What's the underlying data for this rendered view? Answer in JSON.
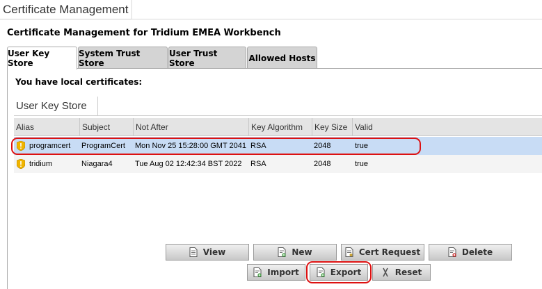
{
  "window": {
    "title": "Certificate Management"
  },
  "heading": "Certificate Management for Tridium EMEA Workbench",
  "tabs": [
    {
      "label": "User Key Store"
    },
    {
      "label": "System Trust Store"
    },
    {
      "label": "User Trust Store"
    },
    {
      "label": "Allowed Hosts"
    }
  ],
  "panel": {
    "message": "You have local certificates:",
    "subtab": "User Key Store"
  },
  "table": {
    "columns": [
      "Alias",
      "Subject",
      "Not After",
      "Key Algorithm",
      "Key Size",
      "Valid"
    ],
    "rows": [
      {
        "alias": "programcert",
        "subject": "ProgramCert",
        "not_after": "Mon Nov 25 15:28:00 GMT 2041",
        "algorithm": "RSA",
        "size": "2048",
        "valid": "true"
      },
      {
        "alias": "tridium",
        "subject": "Niagara4",
        "not_after": "Tue Aug 02 12:42:34 BST 2022",
        "algorithm": "RSA",
        "size": "2048",
        "valid": "true"
      }
    ]
  },
  "buttons": {
    "view": "View",
    "new": "New",
    "cert_request": "Cert Request",
    "delete": "Delete",
    "import": "Import",
    "export": "Export",
    "reset": "Reset"
  },
  "colors": {
    "selection": "#c8dcf5",
    "highlight": "#dd1111",
    "warning_icon": "#f0b400"
  }
}
